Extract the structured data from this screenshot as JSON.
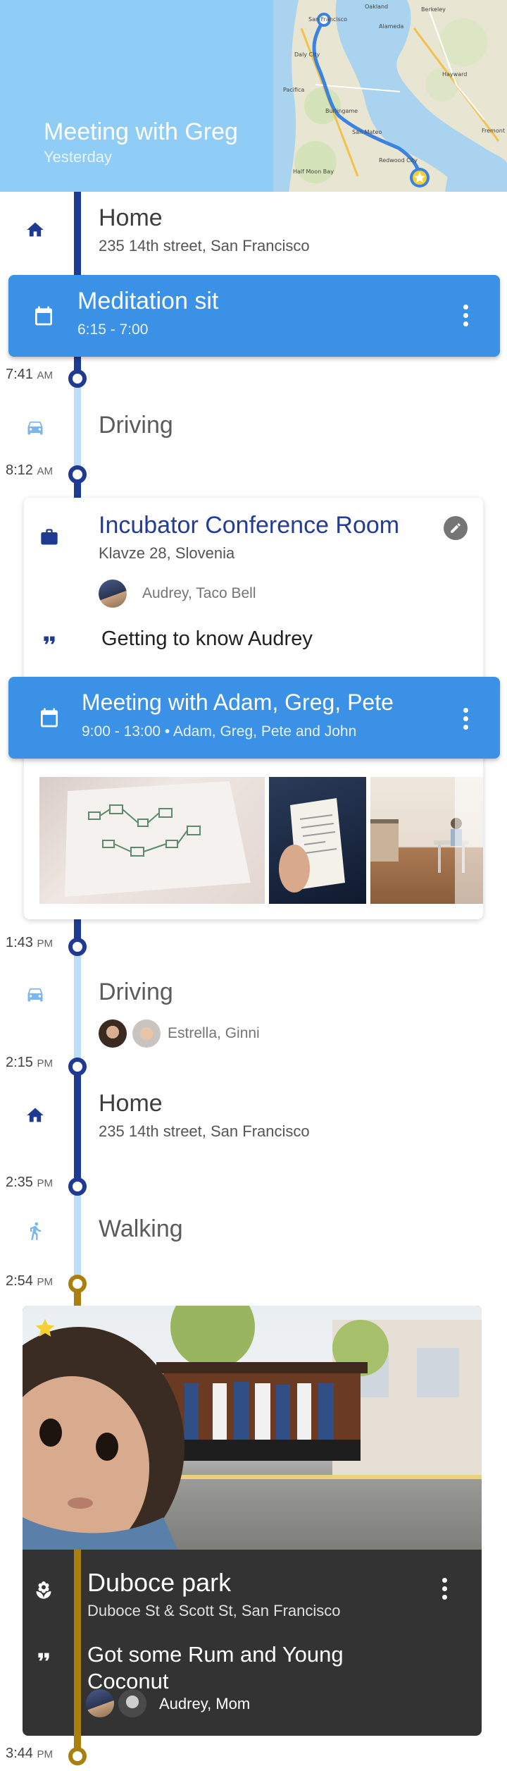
{
  "header": {
    "title": "Meeting with Greg",
    "subtitle": "Yesterday",
    "background": "#8fccf6",
    "map": {
      "labels": [
        "San Francisco",
        "Oakland",
        "Alameda",
        "Hayward",
        "Fremont",
        "San Mateo",
        "Daly City",
        "Pacifica",
        "Burlingame",
        "Redwood City",
        "Half Moon Bay",
        "Berkeley"
      ]
    }
  },
  "colors": {
    "rail_blue": "#1f3a93",
    "rail_light": "#bcdcf7",
    "rail_gold": "#a9800e",
    "event_blue": "#3b91e6"
  },
  "timeline": {
    "home1": {
      "icon": "home-icon",
      "title": "Home",
      "address": "235 14th street, San Francisco"
    },
    "meditation": {
      "icon": "calendar-icon",
      "title": "Meditation sit",
      "time": "6:15 - 7:00"
    },
    "t1": {
      "value": "7:41",
      "ampm": "AM"
    },
    "driving1": {
      "icon": "car-icon",
      "title": "Driving"
    },
    "t2": {
      "value": "8:12",
      "ampm": "AM"
    },
    "visit": {
      "icon": "briefcase-icon",
      "title": "Incubator Conference Room",
      "address": "Klavze 28, Slovenia",
      "people": "Audrey, Taco Bell",
      "note": "Getting to know Audrey"
    },
    "meeting": {
      "icon": "calendar-icon",
      "title": "Meeting with Adam, Greg, Pete",
      "subtitle": "9:00 - 13:00 • Adam, Greg, Pete and John"
    },
    "t3": {
      "value": "1:43",
      "ampm": "PM"
    },
    "driving2": {
      "icon": "car-icon",
      "title": "Driving",
      "people": "Estrella, Ginni"
    },
    "t4": {
      "value": "2:15",
      "ampm": "PM"
    },
    "home2": {
      "icon": "home-icon",
      "title": "Home",
      "address": "235 14th street, San Francisco"
    },
    "t5": {
      "value": "2:35",
      "ampm": "PM"
    },
    "walking": {
      "icon": "walk-icon",
      "title": "Walking"
    },
    "t6": {
      "value": "2:54",
      "ampm": "PM"
    },
    "park": {
      "icon": "flower-icon",
      "title": "Duboce park",
      "address": "Duboce St & Scott St, San Francisco",
      "note": "Got some Rum and Young Coconut",
      "people": "Audrey, Mom"
    },
    "t7": {
      "value": "3:44",
      "ampm": "PM"
    }
  }
}
